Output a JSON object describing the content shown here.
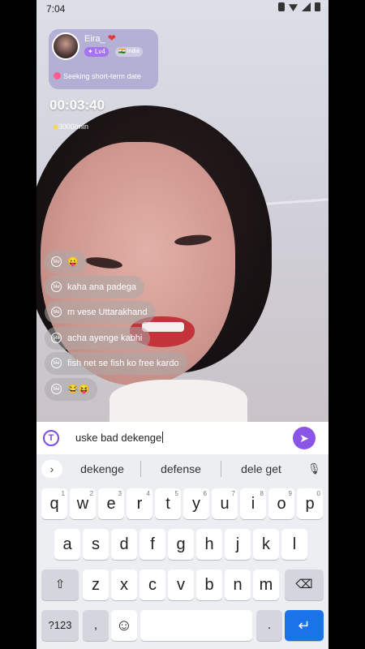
{
  "status_bar": {
    "time": "7:04"
  },
  "profile": {
    "name": "Eira_",
    "level": "Lv4",
    "country": "India",
    "bio": "Seeking short-term date"
  },
  "call": {
    "timer": "00:03:40",
    "rate": "3000/min"
  },
  "chat": {
    "me_badge": "Me",
    "messages": [
      "😛",
      "kaha ana padega",
      "m vese Uttarakhand",
      "acha ayenge kabhi",
      "fish net se fish ko free kardo",
      "😂😝"
    ]
  },
  "input": {
    "logo": "T",
    "value": "uske bad dekenge"
  },
  "keyboard": {
    "suggestions": [
      "dekenge",
      "defense",
      "dele get"
    ],
    "row1": [
      "q",
      "w",
      "e",
      "r",
      "t",
      "y",
      "u",
      "i",
      "o",
      "p"
    ],
    "row1_hints": [
      "1",
      "2",
      "3",
      "4",
      "5",
      "6",
      "7",
      "8",
      "9",
      "0"
    ],
    "row2": [
      "a",
      "s",
      "d",
      "f",
      "g",
      "h",
      "j",
      "k",
      "l"
    ],
    "row3": [
      "z",
      "x",
      "c",
      "v",
      "b",
      "n",
      "m"
    ],
    "symbols_key": "?123",
    "comma_key": ",",
    "period_key": "."
  },
  "colors": {
    "accent": "#8a55e6",
    "enter": "#1a73e8"
  }
}
